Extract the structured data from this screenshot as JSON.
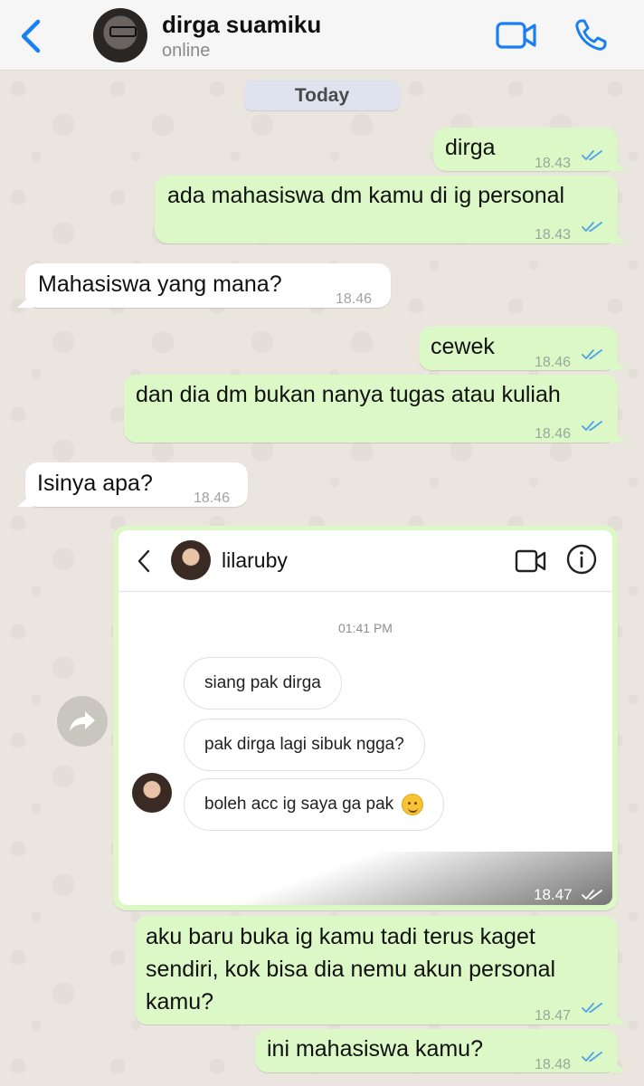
{
  "header": {
    "contact_name": "dirga suamiku",
    "status": "online",
    "back_icon": "chevron-left-icon",
    "video_icon": "video-camera-icon",
    "call_icon": "phone-icon",
    "accent_color": "#1a7ff0"
  },
  "date_separator": "Today",
  "messages": [
    {
      "direction": "out",
      "text": "dirga",
      "time": "18.43",
      "read": true
    },
    {
      "direction": "out",
      "text": "ada mahasiswa dm kamu di ig personal",
      "time": "18.43",
      "read": true
    },
    {
      "direction": "in",
      "text": "Mahasiswa yang mana?",
      "time": "18.46"
    },
    {
      "direction": "out",
      "text": "cewek",
      "time": "18.46",
      "read": true
    },
    {
      "direction": "out",
      "text": "dan dia dm bukan nanya tugas atau kuliah",
      "time": "18.46",
      "read": true
    },
    {
      "direction": "in",
      "text": "Isinya apa?",
      "time": "18.46"
    },
    {
      "direction": "out",
      "type": "image",
      "time": "18.47",
      "read": true,
      "screenshot": {
        "username": "lilaruby",
        "timestamp": "01:41 PM",
        "messages": [
          "siang pak dirga",
          "pak dirga lagi sibuk ngga?",
          "boleh acc ig saya ga pak"
        ],
        "emoji": "smiling-face"
      }
    },
    {
      "direction": "out",
      "lines": [
        "aku baru buka ig kamu tadi terus kaget",
        "sendiri, kok bisa dia nemu akun personal",
        "kamu?"
      ],
      "time": "18.47",
      "read": true
    },
    {
      "direction": "out",
      "text": "ini mahasiswa kamu?",
      "time": "18.48",
      "read": true
    }
  ],
  "colors": {
    "outgoing_bubble": "#dcf8c6",
    "incoming_bubble": "#ffffff",
    "read_ticks": "#4fa3e8"
  }
}
